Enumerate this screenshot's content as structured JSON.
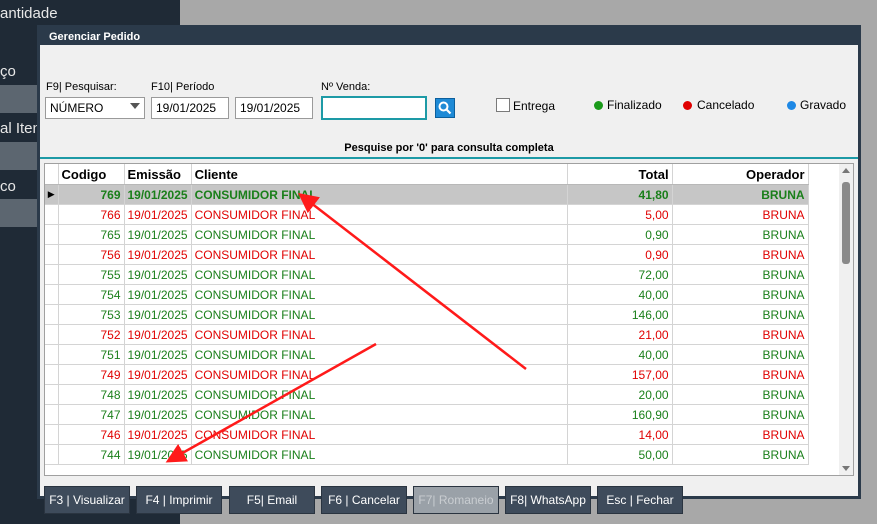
{
  "background": {
    "items": [
      "antidade",
      "ço",
      "al Iten",
      "co"
    ]
  },
  "dialog": {
    "title": "Gerenciar Pedido",
    "search": {
      "label": "F9|  Pesquisar:",
      "value": "NÚMERO"
    },
    "period": {
      "label": "F10| Período",
      "from": "19/01/2025",
      "to": "19/01/2025"
    },
    "venda": {
      "label": "Nº Venda:",
      "value": ""
    },
    "entrega_label": "Entrega",
    "legend": [
      {
        "label": "Finalizado",
        "color": "#1a9a1a"
      },
      {
        "label": "Cancelado",
        "color": "#e00000"
      },
      {
        "label": "Gravado",
        "color": "#1e88e5"
      }
    ],
    "hint": "Pesquise por '0' para consulta completa",
    "grid": {
      "columns": [
        "Codigo",
        "Emissão",
        "Cliente",
        "Total",
        "Operador"
      ],
      "rows": [
        {
          "codigo": "769",
          "emissao": "19/01/2025",
          "cliente": "CONSUMIDOR FINAL",
          "total": "41,80",
          "operador": "BRUNA",
          "status": "green",
          "selected": true
        },
        {
          "codigo": "766",
          "emissao": "19/01/2025",
          "cliente": "CONSUMIDOR FINAL",
          "total": "5,00",
          "operador": "BRUNA",
          "status": "red"
        },
        {
          "codigo": "765",
          "emissao": "19/01/2025",
          "cliente": "CONSUMIDOR FINAL",
          "total": "0,90",
          "operador": "BRUNA",
          "status": "green"
        },
        {
          "codigo": "756",
          "emissao": "19/01/2025",
          "cliente": "CONSUMIDOR FINAL",
          "total": "0,90",
          "operador": "BRUNA",
          "status": "red"
        },
        {
          "codigo": "755",
          "emissao": "19/01/2025",
          "cliente": "CONSUMIDOR FINAL",
          "total": "72,00",
          "operador": "BRUNA",
          "status": "green"
        },
        {
          "codigo": "754",
          "emissao": "19/01/2025",
          "cliente": "CONSUMIDOR FINAL",
          "total": "40,00",
          "operador": "BRUNA",
          "status": "green"
        },
        {
          "codigo": "753",
          "emissao": "19/01/2025",
          "cliente": "CONSUMIDOR FINAL",
          "total": "146,00",
          "operador": "BRUNA",
          "status": "green"
        },
        {
          "codigo": "752",
          "emissao": "19/01/2025",
          "cliente": "CONSUMIDOR FINAL",
          "total": "21,00",
          "operador": "BRUNA",
          "status": "red"
        },
        {
          "codigo": "751",
          "emissao": "19/01/2025",
          "cliente": "CONSUMIDOR FINAL",
          "total": "40,00",
          "operador": "BRUNA",
          "status": "green"
        },
        {
          "codigo": "749",
          "emissao": "19/01/2025",
          "cliente": "CONSUMIDOR FINAL",
          "total": "157,00",
          "operador": "BRUNA",
          "status": "red"
        },
        {
          "codigo": "748",
          "emissao": "19/01/2025",
          "cliente": "CONSUMIDOR FINAL",
          "total": "20,00",
          "operador": "BRUNA",
          "status": "green"
        },
        {
          "codigo": "747",
          "emissao": "19/01/2025",
          "cliente": "CONSUMIDOR FINAL",
          "total": "160,90",
          "operador": "BRUNA",
          "status": "green"
        },
        {
          "codigo": "746",
          "emissao": "19/01/2025",
          "cliente": "CONSUMIDOR FINAL",
          "total": "14,00",
          "operador": "BRUNA",
          "status": "red"
        },
        {
          "codigo": "744",
          "emissao": "19/01/2025",
          "cliente": "CONSUMIDOR FINAL",
          "total": "50,00",
          "operador": "BRUNA",
          "status": "green"
        }
      ]
    },
    "buttons": {
      "visualizar": "F3 | Visualizar",
      "imprimir": "F4 | Imprimir",
      "email": "F5| Email",
      "cancelar": "F6 | Cancelar",
      "romaneio": "F7| Romaneio",
      "whatsapp": "F8| WhatsApp",
      "fechar": "Esc | Fechar"
    }
  },
  "colors": {
    "annotation_arrow": "#ff1a1a",
    "accent": "#1d9aa6"
  }
}
